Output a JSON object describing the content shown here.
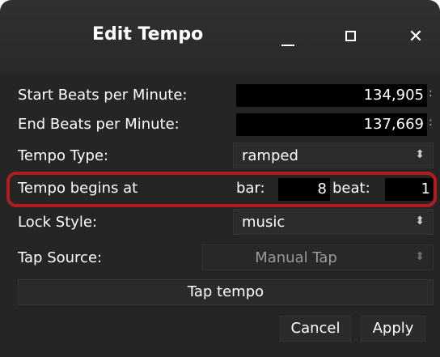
{
  "window": {
    "title": "Edit Tempo",
    "minimize_icon": "minimize-icon",
    "maximize_icon": "maximize-icon",
    "close_label": "✕"
  },
  "fields": {
    "start_bpm": {
      "label": "Start Beats per Minute:",
      "value": "134,905"
    },
    "end_bpm": {
      "label": "End Beats per Minute:",
      "value": "137,669"
    },
    "tempo_type": {
      "label": "Tempo Type:",
      "value": "ramped"
    },
    "tempo_begins": {
      "label": "Tempo begins at",
      "bar_label": "bar:",
      "bar_value": "8",
      "beat_label": "beat:",
      "beat_value": "1"
    },
    "lock_style": {
      "label": "Lock Style:",
      "value": "music"
    },
    "tap_source": {
      "label": "Tap Source:",
      "value": "Manual Tap"
    }
  },
  "buttons": {
    "tap_tempo": "Tap tempo",
    "cancel": "Cancel",
    "apply": "Apply"
  },
  "icons": {
    "combo_arrow": "⌃⌄"
  },
  "colors": {
    "highlight": "#b01c22",
    "background": "#252525",
    "titlebar": "#2d2d2d"
  }
}
